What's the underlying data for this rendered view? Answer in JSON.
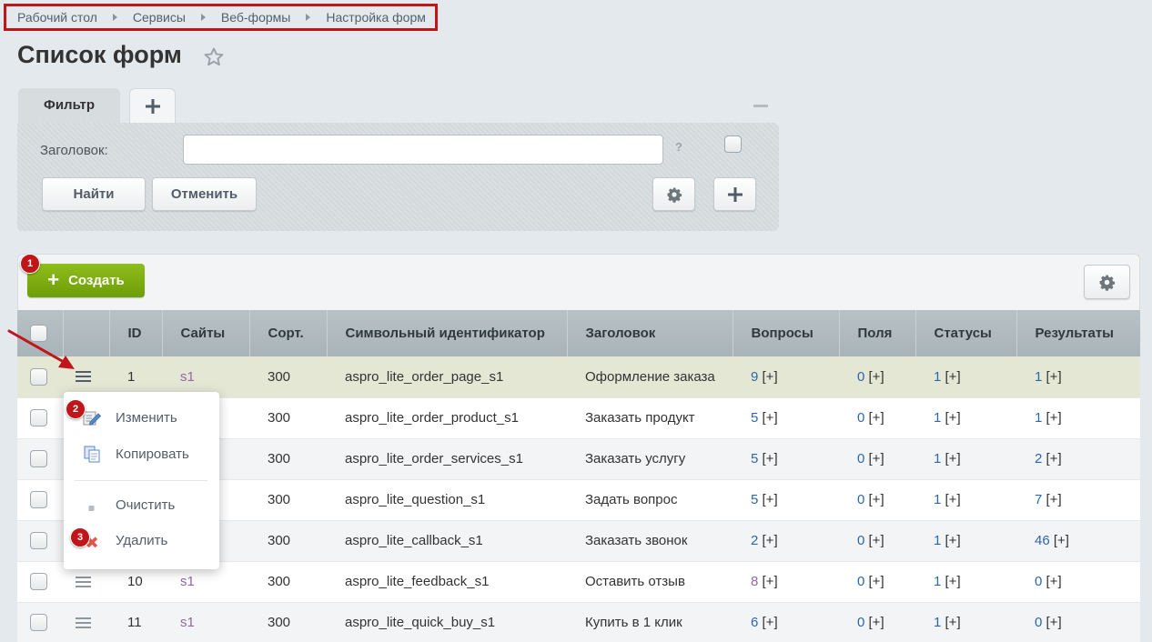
{
  "breadcrumb": {
    "items": [
      "Рабочий стол",
      "Сервисы",
      "Веб-формы",
      "Настройка форм"
    ]
  },
  "page": {
    "title": "Список форм"
  },
  "filter": {
    "tab_label": "Фильтр",
    "field_label": "Заголовок:",
    "field_value": "",
    "help": "?",
    "find_label": "Найти",
    "cancel_label": "Отменить"
  },
  "toolbar": {
    "create_label": "Создать"
  },
  "markers": [
    "1",
    "2",
    "3"
  ],
  "table": {
    "columns": [
      "ID",
      "Сайты",
      "Сорт.",
      "Символьный идентификатор",
      "Заголовок",
      "Вопросы",
      "Поля",
      "Статусы",
      "Результаты"
    ],
    "rows": [
      {
        "id": "1",
        "site": "s1",
        "sort": "300",
        "code": "aspro_lite_order_page_s1",
        "title": "Оформление заказа",
        "questions": "9",
        "fields": "0",
        "statuses": "1",
        "results": "1"
      },
      {
        "id": "",
        "site": "",
        "sort": "300",
        "code": "aspro_lite_order_product_s1",
        "title": "Заказать продукт",
        "questions": "5",
        "fields": "0",
        "statuses": "1",
        "results": "1"
      },
      {
        "id": "",
        "site": "",
        "sort": "300",
        "code": "aspro_lite_order_services_s1",
        "title": "Заказать услугу",
        "questions": "5",
        "fields": "0",
        "statuses": "1",
        "results": "2"
      },
      {
        "id": "",
        "site": "",
        "sort": "300",
        "code": "aspro_lite_question_s1",
        "title": "Задать вопрос",
        "questions": "5",
        "fields": "0",
        "statuses": "1",
        "results": "7"
      },
      {
        "id": "",
        "site": "",
        "sort": "300",
        "code": "aspro_lite_callback_s1",
        "title": "Заказать звонок",
        "questions": "2",
        "fields": "0",
        "statuses": "1",
        "results": "46"
      },
      {
        "id": "10",
        "site": "s1",
        "sort": "300",
        "code": "aspro_lite_feedback_s1",
        "title": "Оставить отзыв",
        "questions": "8",
        "fields": "0",
        "statuses": "1",
        "results": "0"
      },
      {
        "id": "11",
        "site": "s1",
        "sort": "300",
        "code": "aspro_lite_quick_buy_s1",
        "title": "Купить в 1 клик",
        "questions": "6",
        "fields": "0",
        "statuses": "1",
        "results": "0"
      }
    ],
    "plus_label": "[+]"
  },
  "context_menu": {
    "items": [
      "Изменить",
      "Копировать",
      "Очистить",
      "Удалить"
    ]
  },
  "colors": {
    "accent_green": "#7aab0c",
    "marker_red": "#c0161a",
    "link_blue": "#2d67a8",
    "link_visited": "#8f6aa4"
  }
}
